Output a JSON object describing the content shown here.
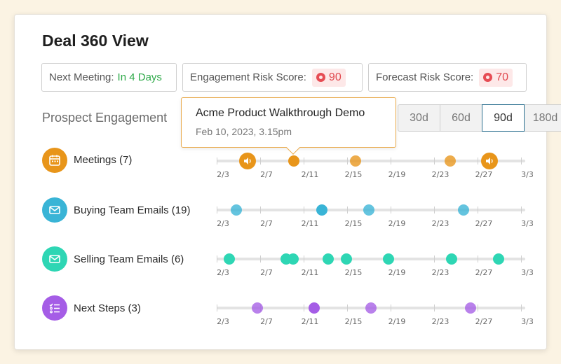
{
  "title": "Deal 360 View",
  "next_meeting": {
    "label": "Next Meeting:",
    "value": "In 4 Days"
  },
  "engagement_risk": {
    "label": "Engagement Risk Score:",
    "value": "90"
  },
  "forecast_risk": {
    "label": "Forecast Risk Score:",
    "value": "70"
  },
  "section_label": "Prospect Engagement",
  "ranges": [
    "30d",
    "60d",
    "90d",
    "180d"
  ],
  "active_range": "90d",
  "tooltip": {
    "title": "Acme Product Walkthrough Demo",
    "subtitle": "Feb 10, 2023,  3.15pm"
  },
  "axis_labels": [
    "2/3",
    "2/7",
    "2/11",
    "2/15",
    "2/19",
    "2/23",
    "2/27",
    "3/3"
  ],
  "colors": {
    "meetings": "#e8951a",
    "buying": "#39b4d6",
    "selling": "#2ed6b4",
    "next_steps": "#a55de6"
  },
  "rows": [
    {
      "key": "meetings",
      "label": "Meetings (7)",
      "icon": "calendar-icon"
    },
    {
      "key": "buying",
      "label": "Buying Team Emails (19)",
      "icon": "mail-icon"
    },
    {
      "key": "selling",
      "label": "Selling Team Emails (6)",
      "icon": "mail-icon"
    },
    {
      "key": "next_steps",
      "label": "Next Steps (3)",
      "icon": "checklist-icon"
    }
  ]
}
